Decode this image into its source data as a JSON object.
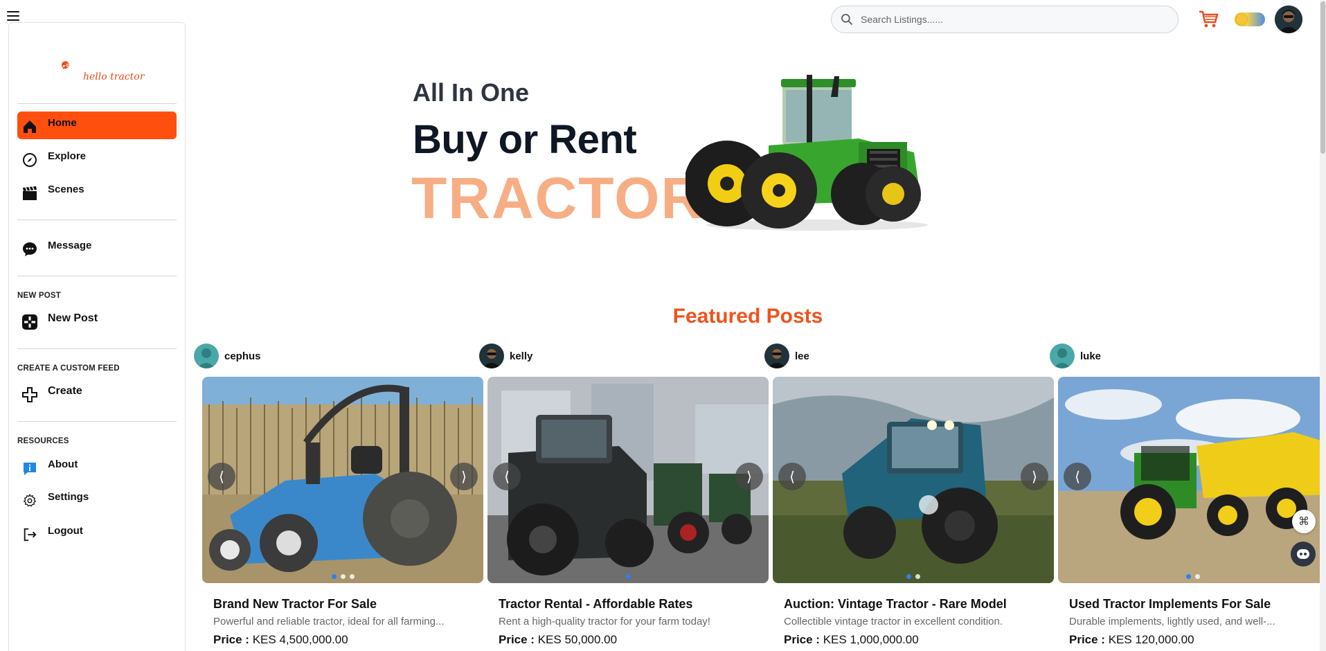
{
  "brand": {
    "logo_text": "hello tractor",
    "color": "#ff4f0f"
  },
  "search": {
    "placeholder": "Search Listings......"
  },
  "sidebar": {
    "main_items": [
      {
        "label": "Home",
        "icon": "home-icon",
        "active": true
      },
      {
        "label": "Explore",
        "icon": "compass-icon"
      },
      {
        "label": "Scenes",
        "icon": "clapperboard-icon"
      }
    ],
    "message": {
      "label": "Message",
      "icon": "chat-icon"
    },
    "new_post_section": "NEW POST",
    "new_post": {
      "label": "New Post",
      "icon": "plus-box-icon"
    },
    "custom_feed_section": "CREATE A CUSTOM FEED",
    "create": {
      "label": "Create",
      "icon": "plus-icon"
    },
    "resources_section": "RESOURCES",
    "resources": [
      {
        "label": "About",
        "icon": "info-icon"
      },
      {
        "label": "Settings",
        "icon": "gear-icon"
      },
      {
        "label": "Logout",
        "icon": "logout-icon"
      }
    ]
  },
  "hero": {
    "subtitle": "All In One",
    "title": "Buy or Rent",
    "accent": "TRACTORS"
  },
  "featured": {
    "title": "Featured Posts",
    "posts": [
      {
        "author": "cephus",
        "title": "Brand New Tractor For Sale",
        "description": "Powerful and reliable tractor, ideal for all farming...",
        "price_label": "Price :",
        "price": "KES 4,500,000.00",
        "image_count": 3
      },
      {
        "author": "kelly",
        "title": "Tractor Rental - Affordable Rates",
        "description": "Rent a high-quality tractor for your farm today!",
        "price_label": "Price :",
        "price": "KES 50,000.00",
        "image_count": 1
      },
      {
        "author": "lee",
        "title": "Auction: Vintage Tractor - Rare Model",
        "description": "Collectible vintage tractor in excellent condition.",
        "price_label": "Price :",
        "price": "KES 1,000,000.00",
        "image_count": 2
      },
      {
        "author": "luke",
        "title": "Used Tractor Implements For Sale",
        "description": "Durable implements, lightly used, and well-...",
        "price_label": "Price :",
        "price": "KES 120,000.00",
        "image_count": 2
      }
    ]
  }
}
